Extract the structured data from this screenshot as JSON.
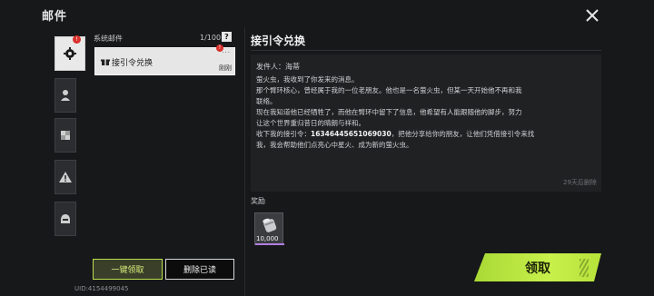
{
  "header": {
    "title": "邮件"
  },
  "list": {
    "category_label": "系统邮件",
    "count": "1/100",
    "help_symbol": "?",
    "items": [
      {
        "subject": "接引令兑换",
        "time": "刚刚",
        "badge": "!",
        "dots": "···"
      }
    ]
  },
  "rail": {
    "badge": "!",
    "items": [
      {
        "icon": "gear-icon",
        "active": true
      },
      {
        "icon": "person-icon",
        "active": false
      },
      {
        "icon": "puzzle-icon",
        "active": false
      },
      {
        "icon": "warning-icon",
        "active": false
      },
      {
        "icon": "helmet-icon",
        "active": false
      }
    ]
  },
  "detail": {
    "title": "接引令兑换",
    "sender": "发件人：海蒂",
    "lines": [
      "萤火虫，我收到了你发来的消息。",
      "那个臂环核心，曾经属于我的一位老朋友。他也是一名萤火虫，但某一天开始他不再和我",
      "联络。",
      "现在我知道他已经牺牲了，而他在臂环中留下了信息，他希望有人能跟随他的脚步，努力",
      "让这个世界重归昔日的晴朗与祥和。"
    ],
    "code_line_prefix": "收下我的接引令：",
    "code": "16346445651069030",
    "code_line_suffix": "，把他分享给你的朋友，让他们凭借接引令来找",
    "last_line": "我，我会帮助他们点亮心中星火、成为新的萤火虫。",
    "expire": "29天后删除",
    "reward_label": "奖励",
    "reward": {
      "icon": "canister-icon",
      "quantity": "10,000"
    }
  },
  "buttons": {
    "one_key_claim": "一键领取",
    "delete_read": "删除已读",
    "claim": "领取"
  },
  "footer": {
    "uid": "UID:4154499045"
  },
  "colors": {
    "accent": "#c8f04b",
    "background": "#17181a",
    "badge": "#d9302c",
    "reward_rarity": "#b07ee0"
  }
}
